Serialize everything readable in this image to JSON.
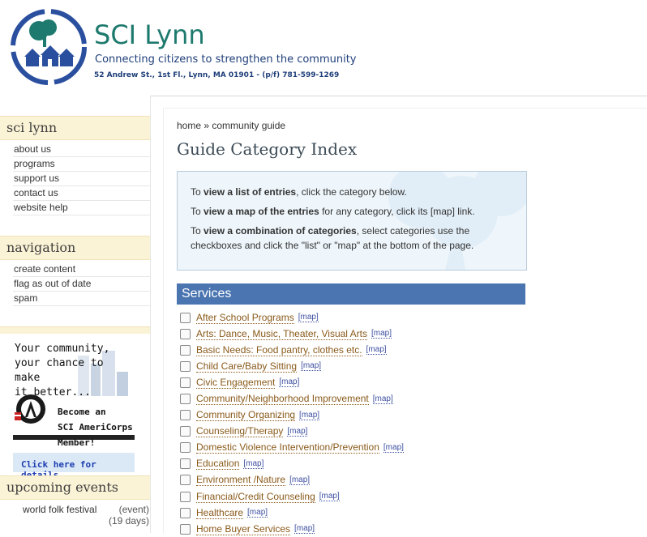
{
  "header": {
    "site_name": "SCI Lynn",
    "slogan": "Connecting citizens to strengthen the community",
    "address": "52 Andrew St., 1st Fl., Lynn, MA 01901 - (p/f) 781-599-1269"
  },
  "sidebar": {
    "sci_lynn_title": "sci lynn",
    "sci_lynn_items": [
      "about us",
      "programs",
      "support us",
      "contact us",
      "website help"
    ],
    "navigation_title": "navigation",
    "navigation_items": [
      "create content",
      "flag as out of date",
      "spam"
    ],
    "ad": {
      "line1": "Your community,",
      "line2": "your chance to make",
      "line3": "it better...",
      "become": "Become an",
      "sci": "SCI AmeriCorps",
      "member": "Member!",
      "cta": "Click here for details"
    },
    "events_title": "upcoming events",
    "event_name": "world folk festival",
    "event_type": "(event)",
    "event_days": "(19 days)"
  },
  "main": {
    "breadcrumb": "home » community guide",
    "title": "Guide Category Index",
    "info": {
      "l1_pre": "To ",
      "l1_bold": "view a list of entries",
      "l1_post": ", click the category below.",
      "l2_pre": "To ",
      "l2_bold": "view a map of the entries",
      "l2_post": " for any category, click its [map] link.",
      "l3_pre": "To ",
      "l3_bold": "view a combination of categories",
      "l3_post": ", select categories use the checkboxes and click the \"list\" or \"map\" at the bottom of the page."
    },
    "section": "Services",
    "map_label": "[map]",
    "categories": [
      "After School Programs",
      "Arts: Dance, Music, Theater, Visual Arts",
      "Basic Needs: Food pantry, clothes etc.",
      "Child Care/Baby Sitting",
      "Civic Engagement",
      "Community/Neighborhood Improvement",
      "Community Organizing",
      "Counseling/Therapy",
      "Domestic Violence Intervention/Prevention",
      "Education",
      "Environment /Nature",
      "Financial/Credit Counseling",
      "Healthcare",
      "Home Buyer Services"
    ]
  },
  "colors": {
    "brand_green": "#1e7a6e",
    "brand_blue": "#1f3f7a",
    "section_bar": "#4a75b0",
    "block_bg": "#fbf3d6",
    "link": "#8a5a1a"
  }
}
